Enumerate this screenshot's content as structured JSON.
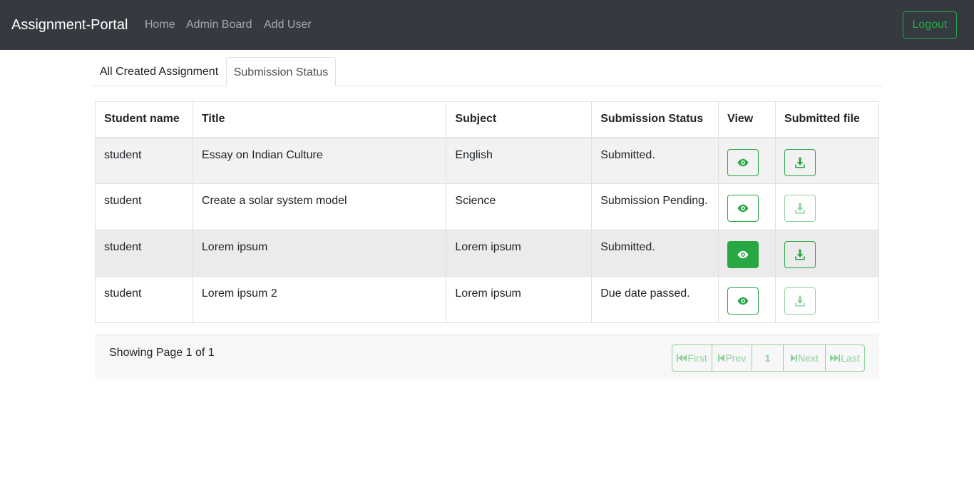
{
  "navbar": {
    "brand": "Assignment-Portal",
    "links": [
      "Home",
      "Admin Board",
      "Add User"
    ],
    "logout": "Logout"
  },
  "tabs": [
    {
      "label": "All Created Assignment",
      "active": false
    },
    {
      "label": "Submission Status",
      "active": true
    }
  ],
  "table": {
    "headers": [
      "Student name",
      "Title",
      "Subject",
      "Submission Status",
      "View",
      "Submitted file"
    ],
    "rows": [
      {
        "student": "student",
        "title": "Essay on Indian Culture",
        "subject": "English",
        "status": "Submitted.",
        "file_available": true
      },
      {
        "student": "student",
        "title": "Create a solar system model",
        "subject": "Science",
        "status": "Submission Pending.",
        "file_available": false
      },
      {
        "student": "student",
        "title": "Lorem ipsum",
        "subject": "Lorem ipsum",
        "status": "Submitted.",
        "file_available": true
      },
      {
        "student": "student",
        "title": "Lorem ipsum 2",
        "subject": "Lorem ipsum",
        "status": "Due date passed.",
        "file_available": false
      }
    ],
    "view_icon": "eye-icon",
    "file_icon": "download-icon"
  },
  "footer": {
    "showing": "Showing Page 1 of 1",
    "pager": {
      "first": "First",
      "prev": "Prev",
      "page": "1",
      "next": "Next",
      "last": "Last"
    }
  },
  "colors": {
    "navbar_bg": "#343a40",
    "accent": "#28a745",
    "accent_faded": "#8fd19e"
  }
}
